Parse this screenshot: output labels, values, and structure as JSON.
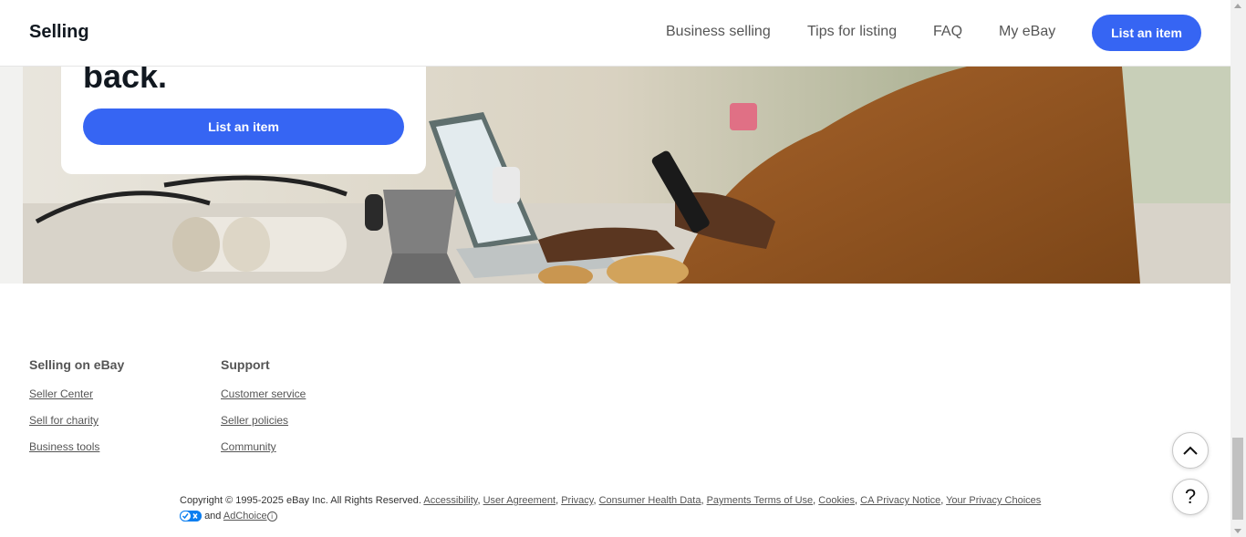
{
  "header": {
    "brand": "Selling",
    "nav": [
      "Business selling",
      "Tips for listing",
      "FAQ",
      "My eBay"
    ],
    "cta": "List an item"
  },
  "hero": {
    "headline": "back.",
    "cta": "List an item"
  },
  "footer": {
    "columns": [
      {
        "title": "Selling on eBay",
        "links": [
          "Seller Center",
          "Sell for charity",
          "Business tools"
        ]
      },
      {
        "title": "Support",
        "links": [
          "Customer service",
          "Seller policies",
          "Community"
        ]
      }
    ],
    "copyright": "Copyright © 1995-2025 eBay Inc. All Rights Reserved.",
    "legal_links": [
      "Accessibility",
      "User Agreement",
      "Privacy",
      "Consumer Health Data",
      "Payments Terms of Use",
      "Cookies",
      "CA Privacy Notice",
      "Your Privacy Choices"
    ],
    "and_text": "and",
    "adchoice": "AdChoice",
    "info_glyph": "i"
  },
  "floating": {
    "help": "?"
  },
  "colors": {
    "accent": "#3665f3",
    "text_muted": "#555555"
  },
  "icons": [
    "chevron-up-icon",
    "help-icon",
    "privacy-choices-icon",
    "info-icon"
  ]
}
